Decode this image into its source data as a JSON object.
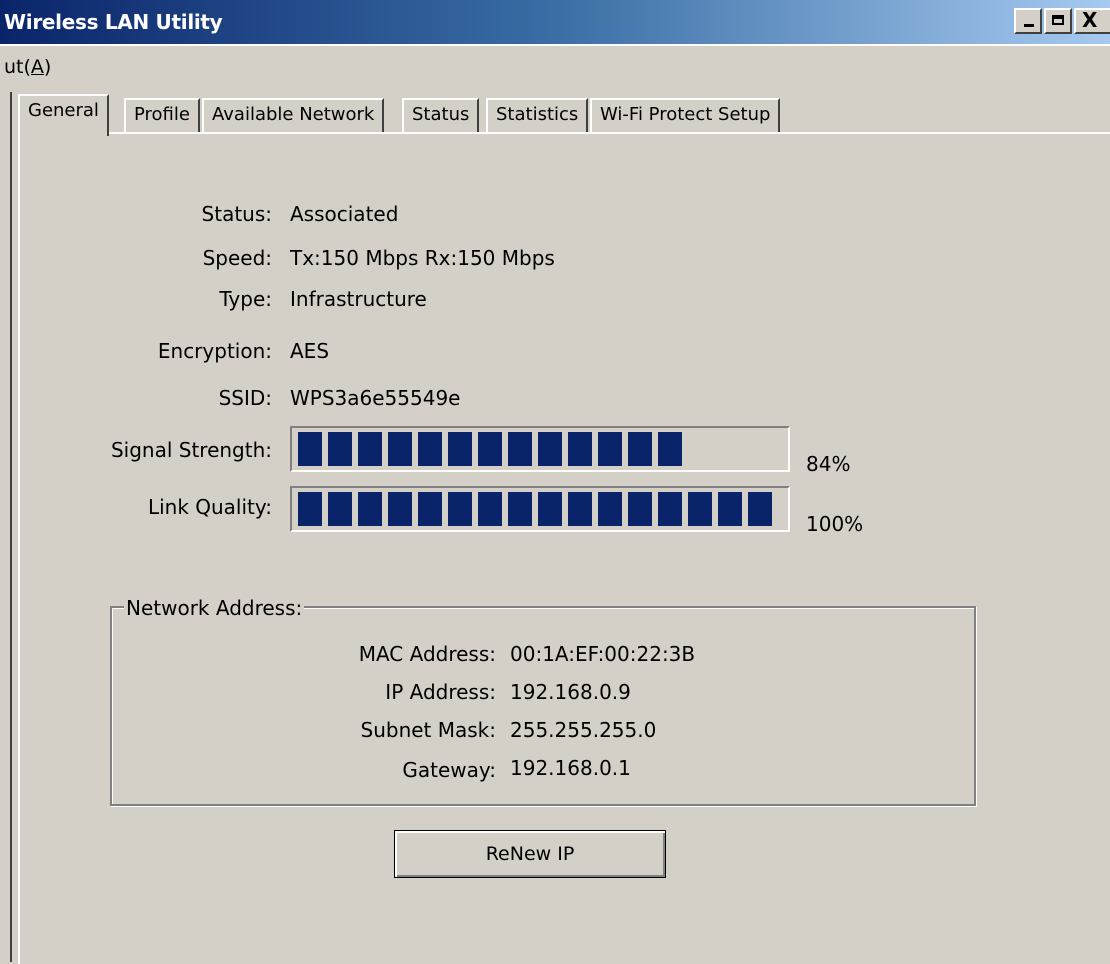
{
  "window": {
    "title": "Wireless LAN Utility",
    "close_glyph": "X"
  },
  "menu": {
    "item_prefix": "ut(",
    "item_accel": "A",
    "item_suffix": ")"
  },
  "tabs": [
    {
      "label": "General",
      "active": true
    },
    {
      "label": "Profile",
      "active": false
    },
    {
      "label": "Available Network",
      "active": false
    },
    {
      "label": "Status",
      "active": false
    },
    {
      "label": "Statistics",
      "active": false
    },
    {
      "label": "Wi-Fi Protect Setup",
      "active": false
    }
  ],
  "general": {
    "status_label": "Status:",
    "status_value": "Associated",
    "speed_label": "Speed:",
    "speed_value": "Tx:150 Mbps Rx:150 Mbps",
    "type_label": "Type:",
    "type_value": "Infrastructure",
    "encryption_label": "Encryption:",
    "encryption_value": "AES",
    "ssid_label": "SSID:",
    "ssid_value": "WPS3a6e55549e",
    "signal_label": "Signal Strength:",
    "signal_percent": 84,
    "signal_text": "84%",
    "link_label": "Link Quality:",
    "link_percent": 100,
    "link_text": "100%"
  },
  "network_address": {
    "legend": "Network Address:",
    "mac_label": "MAC Address:",
    "mac_value": "00:1A:EF:00:22:3B",
    "ip_label": "IP Address:",
    "ip_value": "192.168.0.9",
    "subnet_label": "Subnet Mask:",
    "subnet_value": "255.255.255.0",
    "gateway_label": "Gateway:",
    "gateway_value": "192.168.0.1"
  },
  "renew_button_label": "ReNew IP",
  "colors": {
    "bar_fill": "#0a246a",
    "face": "#d4d0c8"
  }
}
